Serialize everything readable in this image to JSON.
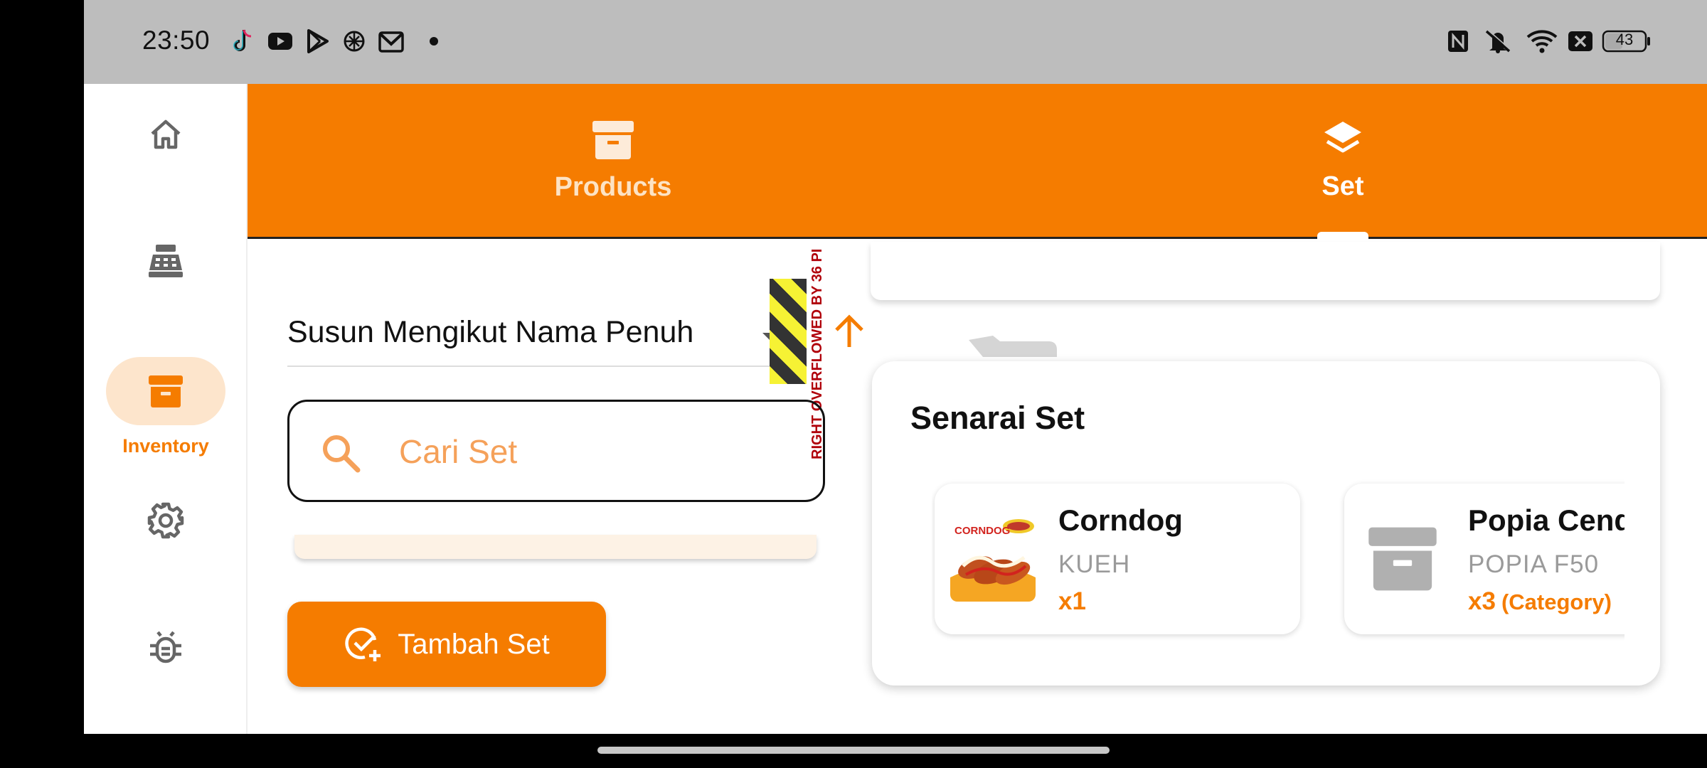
{
  "status_bar": {
    "time": "23:50",
    "left_icons": [
      "tiktok-icon",
      "youtube-icon",
      "play-store-icon",
      "chatgpt-icon",
      "gmail-icon"
    ],
    "right_icons": [
      "nfc-icon",
      "vibrate-off-icon",
      "wifi-icon",
      "no-sim-icon"
    ],
    "battery": "43"
  },
  "rail": {
    "items": [
      {
        "icon": "home-icon",
        "label": ""
      },
      {
        "icon": "cash-register-icon",
        "label": ""
      },
      {
        "icon": "inventory-box-icon",
        "label": "Inventory",
        "active": true
      },
      {
        "icon": "settings-gear-icon",
        "label": ""
      },
      {
        "icon": "bug-icon",
        "label": ""
      }
    ]
  },
  "tabs": [
    {
      "icon": "archive-box-icon",
      "label": "Products",
      "selected": false
    },
    {
      "icon": "layers-icon",
      "label": "Set",
      "selected": true
    }
  ],
  "sort": {
    "label": "Susun Mengikut Nama Penuh",
    "overflow_text": "RIGHT OVERFLOWED BY 36 PI"
  },
  "search": {
    "placeholder": "Cari Set"
  },
  "add_button": {
    "label": "Tambah Set"
  },
  "set_list": {
    "title": "Senarai Set",
    "items": [
      {
        "name": "Corndog",
        "category": "KUEH",
        "qty": "x1",
        "qty_note": "",
        "thumb": "corndog-photo",
        "thumb_label": "CORNDOG"
      },
      {
        "name": "Popia Cend",
        "category": "POPIA F50",
        "qty": "x3",
        "qty_note": "(Category)",
        "thumb": "archive-box-icon"
      }
    ]
  },
  "colors": {
    "accent": "#f57c00",
    "accent_light": "#fde5cc",
    "status_bar": "#bdbdbd",
    "placeholder": "#f5a15a"
  }
}
